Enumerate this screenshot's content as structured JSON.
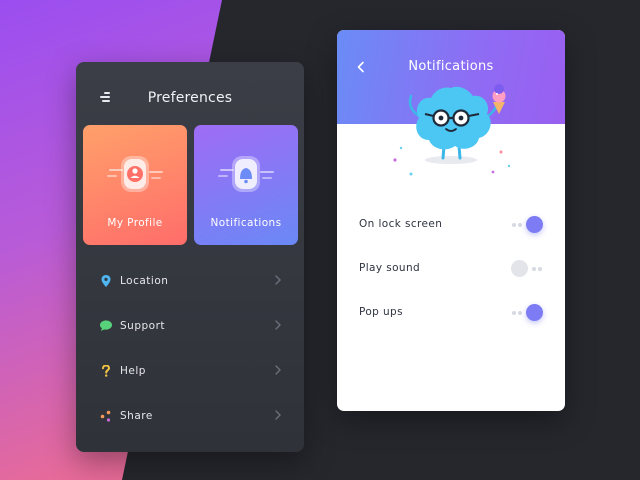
{
  "left_panel": {
    "title": "Preferences",
    "cards": [
      {
        "label": "My Profile",
        "icon": "profile-icon"
      },
      {
        "label": "Notifications",
        "icon": "notification-icon"
      }
    ],
    "menu": [
      {
        "label": "Location",
        "icon": "location-pin-icon",
        "icon_color": "#4fb6f2"
      },
      {
        "label": "Support",
        "icon": "chat-bubble-icon",
        "icon_color": "#58d27a"
      },
      {
        "label": "Help",
        "icon": "question-mark-icon",
        "icon_color": "#f4c542"
      },
      {
        "label": "Share",
        "icon": "share-icon",
        "icon_color": "#f39a5b"
      }
    ]
  },
  "right_panel": {
    "title": "Notifications",
    "settings": [
      {
        "label": "On lock screen",
        "enabled": true
      },
      {
        "label": "Play sound",
        "enabled": false
      },
      {
        "label": "Pop ups",
        "enabled": true
      }
    ]
  },
  "colors": {
    "accent": "#7d7cf5",
    "profile_card": "#ff7b6a",
    "notifications_card": "#7d7cf5",
    "header_gradient": "#8e6cf4"
  }
}
